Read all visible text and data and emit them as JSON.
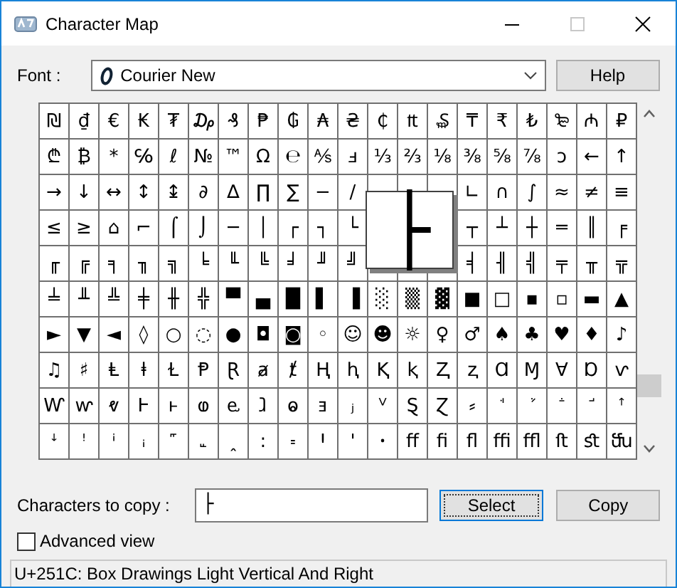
{
  "window": {
    "title": "Character Map"
  },
  "font": {
    "label": "Font :",
    "value": "Courier New"
  },
  "help_button": "Help",
  "grid": {
    "rows": [
      [
        "₪",
        "₫",
        "€",
        "₭",
        "₮",
        "₯",
        "₰",
        "₱",
        "₲",
        "₳",
        "₴",
        "₵",
        "₶",
        "₷",
        "₸",
        "₹",
        "₺",
        "₻",
        "₼",
        "₽"
      ],
      [
        "₾",
        "₿",
        "*",
        "℅",
        "ℓ",
        "№",
        "™",
        "Ω",
        "℮",
        "⅍",
        "ⅎ",
        "⅓",
        "⅔",
        "⅛",
        "⅜",
        "⅝",
        "⅞",
        "ↄ",
        "←",
        "↑"
      ],
      [
        "→",
        "↓",
        "↔",
        "↕",
        "↨",
        "∂",
        "∆",
        "∏",
        "∑",
        "−",
        "∕",
        null,
        null,
        null,
        "∟",
        "∩",
        "∫",
        "≈",
        "≠",
        "≡"
      ],
      [
        "≤",
        "≥",
        "⌂",
        "⌐",
        "⌠",
        "⌡",
        "─",
        "│",
        "┌",
        "┐",
        "└",
        null,
        null,
        null,
        "┬",
        "┴",
        "┼",
        "═",
        "║",
        "╒"
      ],
      [
        "╓",
        "╔",
        "╕",
        "╖",
        "╗",
        "╘",
        "╙",
        "╚",
        "╛",
        "╜",
        "╝",
        null,
        null,
        null,
        "╡",
        "╢",
        "╣",
        "╤",
        "╥",
        "╦"
      ],
      [
        "╧",
        "╨",
        "╩",
        "╪",
        "╫",
        "╬",
        "▀",
        "▄",
        "█",
        "▌",
        "▐",
        "░",
        "▒",
        "▓",
        "■",
        "□",
        "▪",
        "▫",
        "▬",
        "▲"
      ],
      [
        "►",
        "▼",
        "◄",
        "◊",
        "○",
        "◌",
        "●",
        "◘",
        "◙",
        "◦",
        "☺",
        "☻",
        "☼",
        "♀",
        "♂",
        "♠",
        "♣",
        "♥",
        "♦",
        "♪"
      ],
      [
        "♫",
        "♯",
        "Ⱡ",
        "ⱡ",
        "Ɫ",
        "Ᵽ",
        "Ɽ",
        "ⱥ",
        "ⱦ",
        "Ⱨ",
        "ⱨ",
        "Ⱪ",
        "ⱪ",
        "Ⱬ",
        "ⱬ",
        "Ɑ",
        "Ɱ",
        "Ɐ",
        "Ɒ",
        "ⱱ"
      ],
      [
        "Ⱳ",
        "ⱳ",
        "ⱴ",
        "Ⱶ",
        "ⱶ",
        "ⱷ",
        "ⱸ",
        "ⱹ",
        "ⱺ",
        "ⱻ",
        "ⱼ",
        "ⱽ",
        "Ȿ",
        "Ɀ",
        "⸗",
        "ꜗ",
        "ꜘ",
        "ꜙ",
        "ꜚ",
        "ꜛ"
      ],
      [
        "ꜜ",
        "ꜝ",
        "ꜞ",
        "ꜟ",
        "꜠",
        "꜡",
        "ꞈ",
        "꞉",
        "꞊",
        "Ꞌ",
        "ꞌ",
        "ꞏ",
        "ﬀ",
        "ﬁ",
        "ﬂ",
        "ﬃ",
        "ﬄ",
        "ﬅ",
        "ﬆ",
        "ﬓ"
      ]
    ],
    "magnified": "├"
  },
  "copy": {
    "label": "Characters to copy :",
    "value": "├"
  },
  "select_button": {
    "label": "Select",
    "focused": true
  },
  "copy_button": "Copy",
  "advanced_view": {
    "label": "Advanced view",
    "checked": false
  },
  "status_bar": "U+251C: Box Drawings Light Vertical And Right"
}
